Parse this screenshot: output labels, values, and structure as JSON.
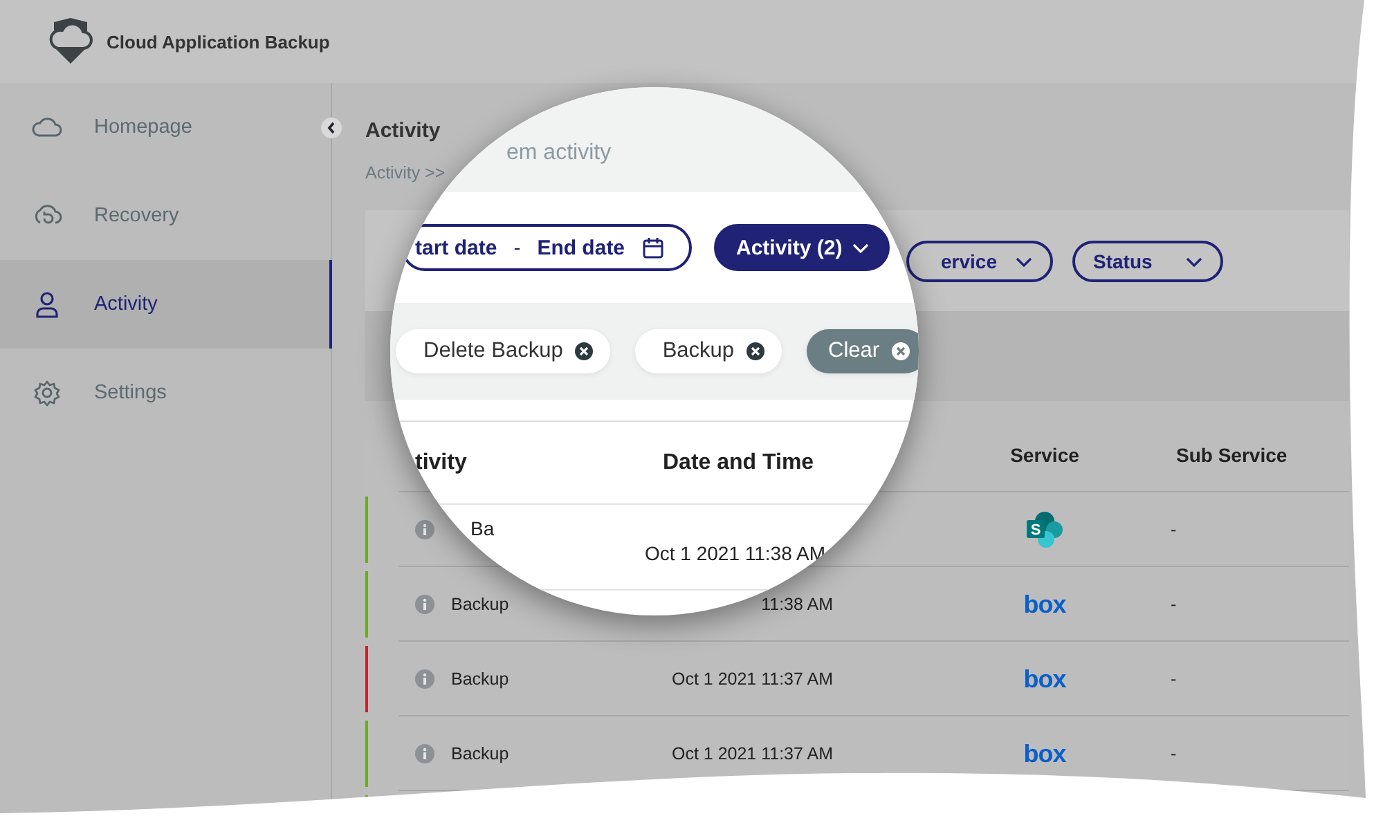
{
  "header": {
    "title": "Cloud Application Backup"
  },
  "sidebar": {
    "items": [
      {
        "label": "Homepage",
        "kind": "cloud",
        "selected": false
      },
      {
        "label": "Recovery",
        "kind": "restore",
        "selected": false
      },
      {
        "label": "Activity",
        "kind": "person",
        "selected": true
      },
      {
        "label": "Settings",
        "kind": "gear",
        "selected": false
      }
    ]
  },
  "page": {
    "title": "Activity",
    "subtitle": "em activity",
    "breadcrumb": "Activity >>"
  },
  "filters": [
    {
      "kind": "date",
      "start": "tart date",
      "separator": "-",
      "end": "End date",
      "selected": false
    },
    {
      "kind": "dropdown",
      "label": "Activity (2)",
      "selected": true
    },
    {
      "kind": "dropdown",
      "label": "ervice",
      "selected": false
    },
    {
      "kind": "dropdown",
      "label": "Status",
      "selected": false
    }
  ],
  "chips": [
    {
      "label": "Delete Backup"
    },
    {
      "label": "Backup"
    }
  ],
  "clear": {
    "label": "Clear"
  },
  "table": {
    "columns": [
      "tivity",
      "Date and Time",
      "Service",
      "Sub Service"
    ],
    "rows": [
      {
        "color": "#6aaa2a",
        "activity": "Ba",
        "date": "Oct 1 2021 11:38 AM",
        "service": {
          "kind": "sharepoint",
          "label": "S"
        },
        "sub_service": "-"
      },
      {
        "color": "#6aaa2a",
        "activity": "Backup",
        "date": "11:38 AM",
        "service": {
          "kind": "box",
          "label": "box"
        },
        "sub_service": "-"
      },
      {
        "color": "#c0272d",
        "activity": "Backup",
        "date": "Oct 1 2021 11:37 AM",
        "service": {
          "kind": "box",
          "label": "box"
        },
        "sub_service": "-"
      },
      {
        "color": "#6aaa2a",
        "activity": "Backup",
        "date": "Oct 1 2021 11:37 AM",
        "service": {
          "kind": "box",
          "label": "box"
        },
        "sub_service": "-"
      },
      {
        "color": "#6aaa2a"
      }
    ]
  }
}
